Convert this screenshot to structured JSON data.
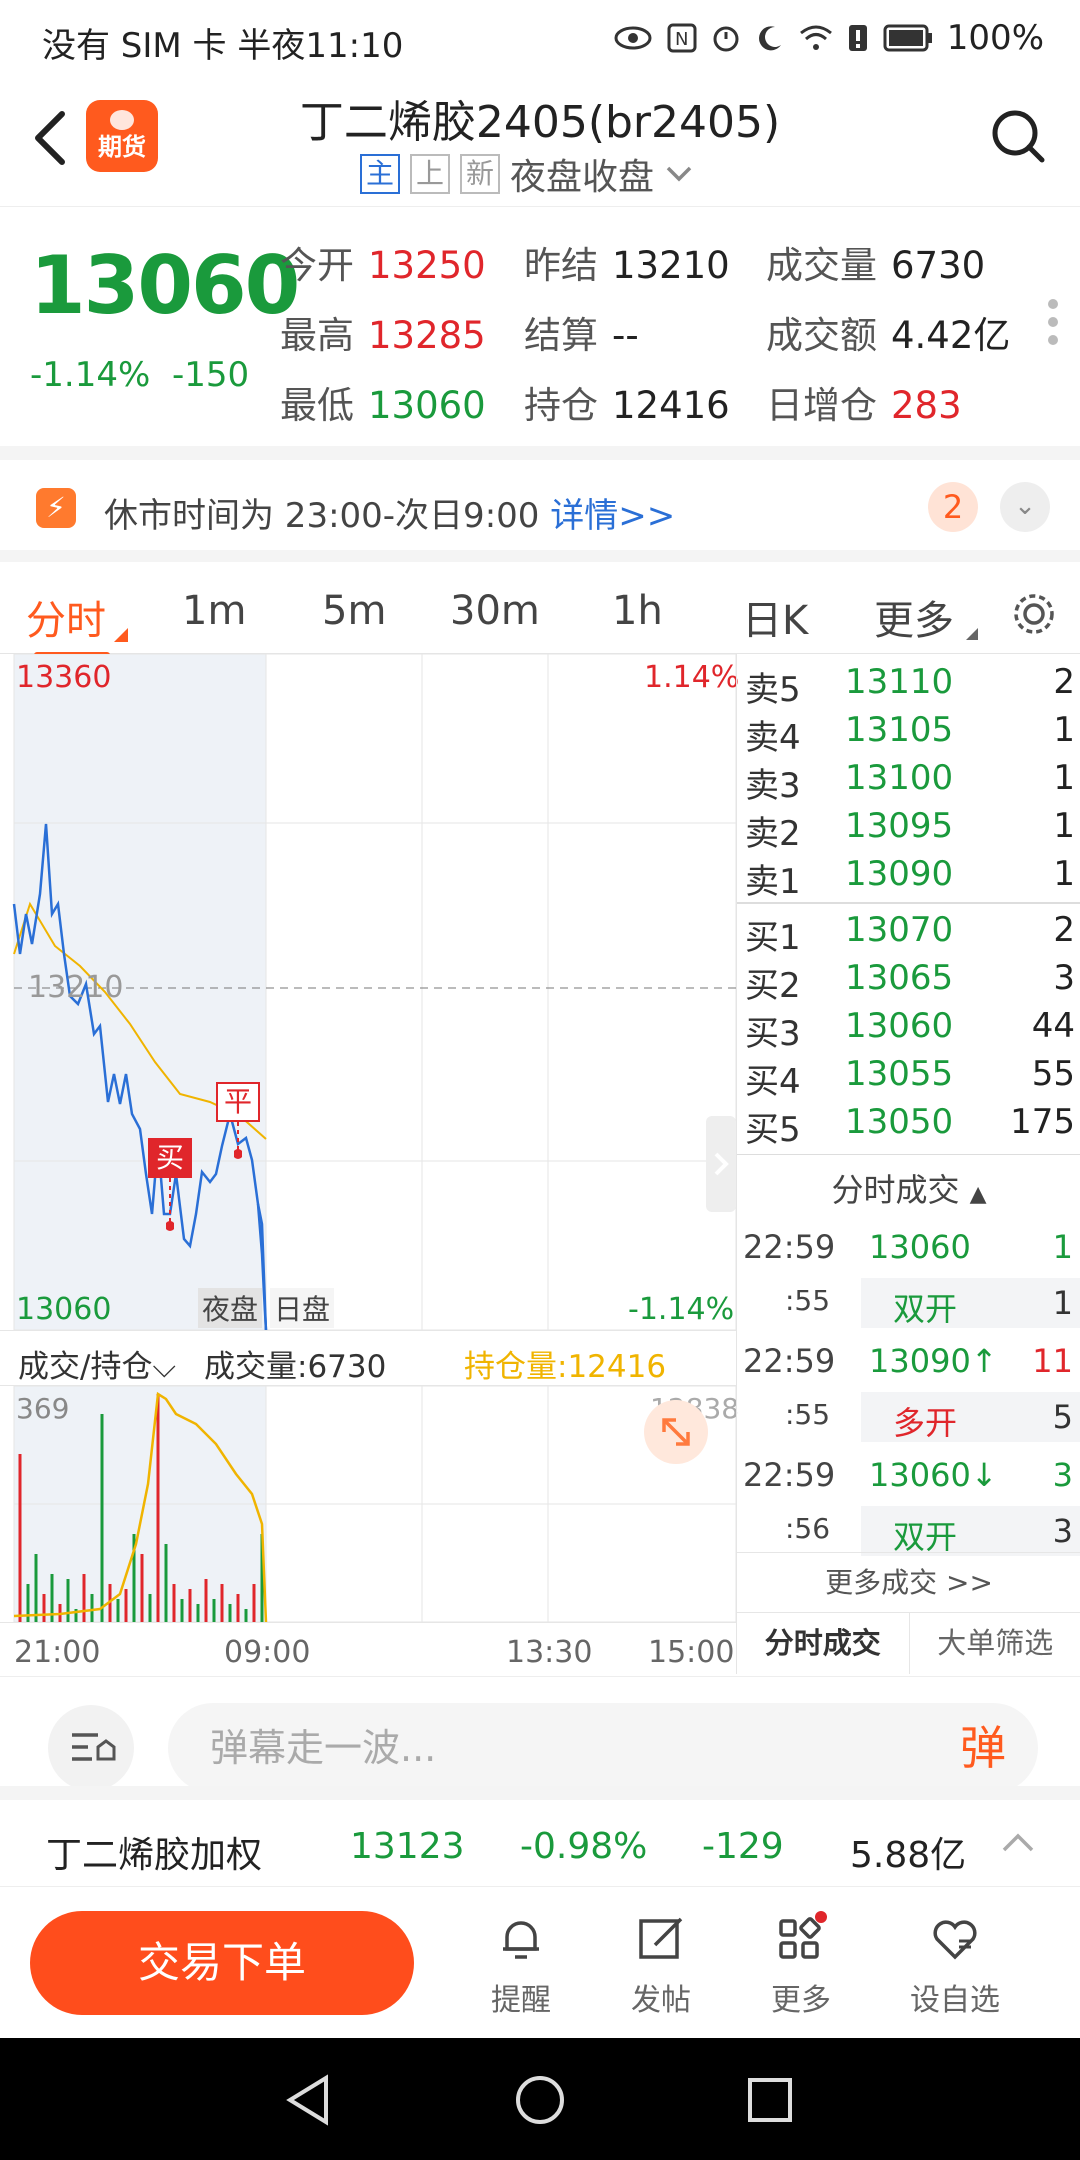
{
  "status_bar": {
    "left": "没有 SIM 卡 半夜11:10",
    "battery": "100%"
  },
  "header": {
    "title": "丁二烯胶2405(br2405)",
    "tags": [
      "主",
      "上",
      "新"
    ],
    "session": "夜盘收盘",
    "logo_text": "期货"
  },
  "quote": {
    "price": "13060",
    "change_pct": "-1.14%",
    "change": "-150",
    "fields": [
      {
        "label": "今开",
        "value": "13250"
      },
      {
        "label": "昨结",
        "value": "13210"
      },
      {
        "label": "成交量",
        "value": "6730"
      },
      {
        "label": "最高",
        "value": "13285"
      },
      {
        "label": "结算",
        "value": "--"
      },
      {
        "label": "成交额",
        "value": "4.42亿"
      },
      {
        "label": "最低",
        "value": "13060"
      },
      {
        "label": "持仓",
        "value": "12416"
      },
      {
        "label": "日增仓",
        "value": "283"
      }
    ]
  },
  "notice": {
    "text": "休市时间为 23:00-次日9:00",
    "link": "详情>>",
    "count": "2"
  },
  "tabs": [
    "分时",
    "1m",
    "5m",
    "30m",
    "1h",
    "日K",
    "更多"
  ],
  "chart": {
    "top_price": "13360",
    "top_pct": "1.14%",
    "mid_price": "13210",
    "bottom_price": "13060",
    "bottom_pct": "-1.14%",
    "session_labels": [
      "夜盘",
      "日盘"
    ],
    "markers": [
      "买",
      "平"
    ],
    "indicator_selector": "成交/持仓",
    "volume_label": "成交量:6730",
    "oi_label": "持仓量:12416",
    "vol_max": "369",
    "oi_max": "12838",
    "x_labels": [
      "21:00",
      "09:00",
      "13:30",
      "15:00"
    ]
  },
  "orderbook": {
    "asks": [
      {
        "label": "卖5",
        "price": "13110",
        "qty": "2"
      },
      {
        "label": "卖4",
        "price": "13105",
        "qty": "1"
      },
      {
        "label": "卖3",
        "price": "13100",
        "qty": "1"
      },
      {
        "label": "卖2",
        "price": "13095",
        "qty": "1"
      },
      {
        "label": "卖1",
        "price": "13090",
        "qty": "1"
      }
    ],
    "bids": [
      {
        "label": "买1",
        "price": "13070",
        "qty": "2"
      },
      {
        "label": "买2",
        "price": "13065",
        "qty": "3"
      },
      {
        "label": "买3",
        "price": "13060",
        "qty": "44"
      },
      {
        "label": "买4",
        "price": "13055",
        "qty": "55"
      },
      {
        "label": "买5",
        "price": "13050",
        "qty": "175"
      }
    ],
    "trades_header": "分时成交",
    "trades": [
      {
        "time": "22:59",
        "sec": ":55",
        "price": "13060",
        "vol": "1",
        "type": "双开",
        "type_vol": "1"
      },
      {
        "time": "22:59",
        "sec": ":55",
        "price": "13090↑",
        "vol": "11",
        "type": "多开",
        "type_vol": "5"
      },
      {
        "time": "22:59",
        "sec": ":56",
        "price": "13060↓",
        "vol": "3",
        "type": "双开",
        "type_vol": "3"
      }
    ],
    "more_trades": "更多成交 >>",
    "bottom_tabs": [
      "分时成交",
      "大单筛选"
    ]
  },
  "danmu": {
    "placeholder": "弹幕走一波...",
    "button": "弹"
  },
  "weighted": {
    "name": "丁二烯胶加权",
    "price": "13123",
    "pct": "-0.98%",
    "chg": "-129",
    "amount": "5.88亿"
  },
  "bottom_bar": {
    "trade_button": "交易下单",
    "nav": [
      "提醒",
      "发帖",
      "更多",
      "设自选"
    ]
  },
  "colors": {
    "up": "#e0262b",
    "down": "#1a9a3c",
    "accent": "#ff5a1e",
    "line": "#2a6fd6",
    "avg": "#f0b400"
  }
}
